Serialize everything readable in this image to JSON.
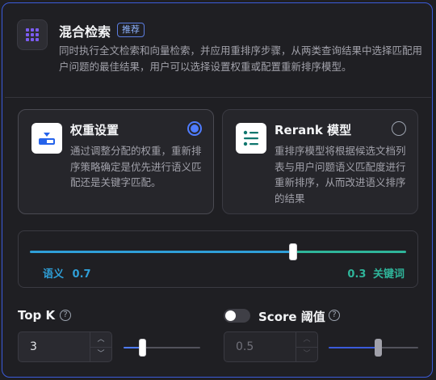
{
  "header": {
    "title": "混合检索",
    "badge": "推荐",
    "description": "同时执行全文检索和向量检索，并应用重排序步骤，从两类查询结果中选择匹配用户问题的最佳结果，用户可以选择设置权重或配置重新排序模型。",
    "icon": "grid-dots-icon"
  },
  "modes": [
    {
      "title": "权重设置",
      "description": "通过调整分配的权重，重新排序策略确定是优先进行语义匹配还是关键字匹配。",
      "selected": true,
      "icon": "weight-settings-icon"
    },
    {
      "title": "Rerank 模型",
      "description": "重排序模型将根据候选文档列表与用户问题语义匹配度进行重新排序，从而改进语义排序的结果",
      "selected": false,
      "icon": "rerank-icon"
    }
  ],
  "weights": {
    "semantic_label": "语义",
    "semantic_value": "0.7",
    "keyword_value": "0.3",
    "keyword_label": "关键词",
    "semantic_fraction": 0.7,
    "semantic_color": "#2f9fd8",
    "keyword_color": "#2fb59a"
  },
  "top_k": {
    "label": "Top K",
    "value": "3",
    "slider_fraction": 0.25
  },
  "score_threshold": {
    "label": "Score 阈值",
    "enabled": false,
    "value": "0.5",
    "slider_fraction": 0.55
  },
  "stepper": {
    "up": "︿",
    "down": "﹀"
  },
  "colors": {
    "accent": "#4f7cff",
    "border": "#3b5bdb"
  }
}
